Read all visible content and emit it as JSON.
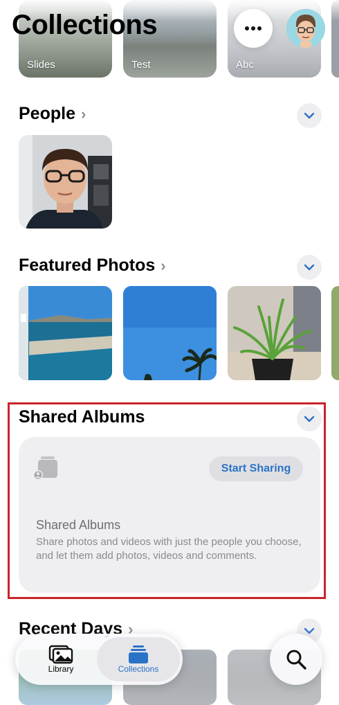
{
  "header": {
    "title": "Collections",
    "more_label": "More options",
    "profile_label": "Profile"
  },
  "albums": [
    {
      "label": "Slides"
    },
    {
      "label": "Test"
    },
    {
      "label": "Abc"
    }
  ],
  "people": {
    "title": "People"
  },
  "featured": {
    "title": "Featured Photos"
  },
  "shared": {
    "title": "Shared Albums",
    "start_label": "Start Sharing",
    "card_title": "Shared Albums",
    "card_desc": "Share photos and videos with just the people you choose, and let them add photos, videos and comments."
  },
  "recent": {
    "title": "Recent Days"
  },
  "tabbar": {
    "library_label": "Library",
    "collections_label": "Collections"
  },
  "colors": {
    "accent": "#2a72c6",
    "highlight_border": "#c9242b"
  }
}
